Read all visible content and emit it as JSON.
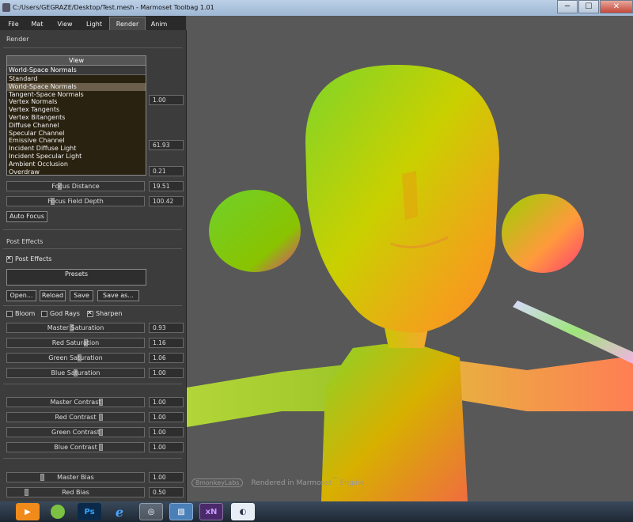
{
  "window": {
    "title": "C:/Users/GEGRAZE/Desktop/Test.mesh - Marmoset Toolbag 1.01",
    "min_label": "─",
    "max_label": "☐",
    "close_label": "✕"
  },
  "menu": {
    "tabs": [
      "File",
      "Mat",
      "View",
      "Light",
      "Render",
      "Anim"
    ],
    "active": "Render"
  },
  "panel": {
    "render_header": "Render",
    "view_dropdown": {
      "header": "View",
      "current": "World-Space Normals",
      "options": [
        "Standard",
        "World-Space Normals",
        "Tangent-Space Normals",
        "Vertex Normals",
        "Vertex Tangents",
        "Vertex Bitangents",
        "Diffuse Channel",
        "Specular Channel",
        "Emissive Channel",
        "Incident Diffuse Light",
        "Incident Specular Light",
        "Ambient Occlusion",
        "Overdraw"
      ],
      "selected_index": 1
    },
    "hidden_values": [
      "1.00",
      "61.93",
      "0.21"
    ],
    "focus_distance": {
      "label": "Focus Distance",
      "value": "19.51",
      "level": 0.38
    },
    "focus_field_depth": {
      "label": "Focus Field Depth",
      "value": "100.42",
      "level": 0.33
    },
    "auto_focus_label": "Auto Focus",
    "post_effects_header": "Post Effects",
    "post_effects_check": {
      "label": "Post Effects",
      "checked": true
    },
    "presets_label": "Presets",
    "buttons": {
      "open": "Open...",
      "reload": "Reload",
      "save": "Save",
      "save_as": "Save as..."
    },
    "checks": {
      "bloom": {
        "label": "Bloom",
        "checked": false
      },
      "god_rays": {
        "label": "God Rays",
        "checked": false
      },
      "sharpen": {
        "label": "Sharpen",
        "checked": true
      }
    },
    "saturation": [
      {
        "label": "Master Saturation",
        "value": "0.93",
        "level": 0.47
      },
      {
        "label": "Red Saturation",
        "value": "1.16",
        "level": 0.58
      },
      {
        "label": "Green Saturation",
        "value": "1.06",
        "level": 0.53
      },
      {
        "label": "Blue Saturation",
        "value": "1.00",
        "level": 0.5
      }
    ],
    "contrast": [
      {
        "label": "Master Contrast",
        "value": "1.00",
        "level": 0.69
      },
      {
        "label": "Red Contrast",
        "value": "1.00",
        "level": 0.69
      },
      {
        "label": "Green Contrast",
        "value": "1.00",
        "level": 0.69
      },
      {
        "label": "Blue Contrast",
        "value": "1.00",
        "level": 0.69
      }
    ],
    "bias": [
      {
        "label": "Master Bias",
        "value": "1.00",
        "level": 0.25
      },
      {
        "label": "Red Bias",
        "value": "0.50",
        "level": 0.13
      }
    ]
  },
  "viewport": {
    "logo_text": "8monkeyLabs",
    "watermark_prefix": "Rendered in Marmoset",
    "tm": "™",
    "watermark_suffix": "Engine"
  },
  "taskbar": {
    "icons": [
      "media-player-icon",
      "spotify-icon",
      "photoshop-icon",
      "internet-explorer-icon",
      "unity-icon",
      "picture-icon",
      "xnormal-icon",
      "marmoset-icon"
    ],
    "ps_label": "Ps",
    "xn_label": "xN"
  }
}
